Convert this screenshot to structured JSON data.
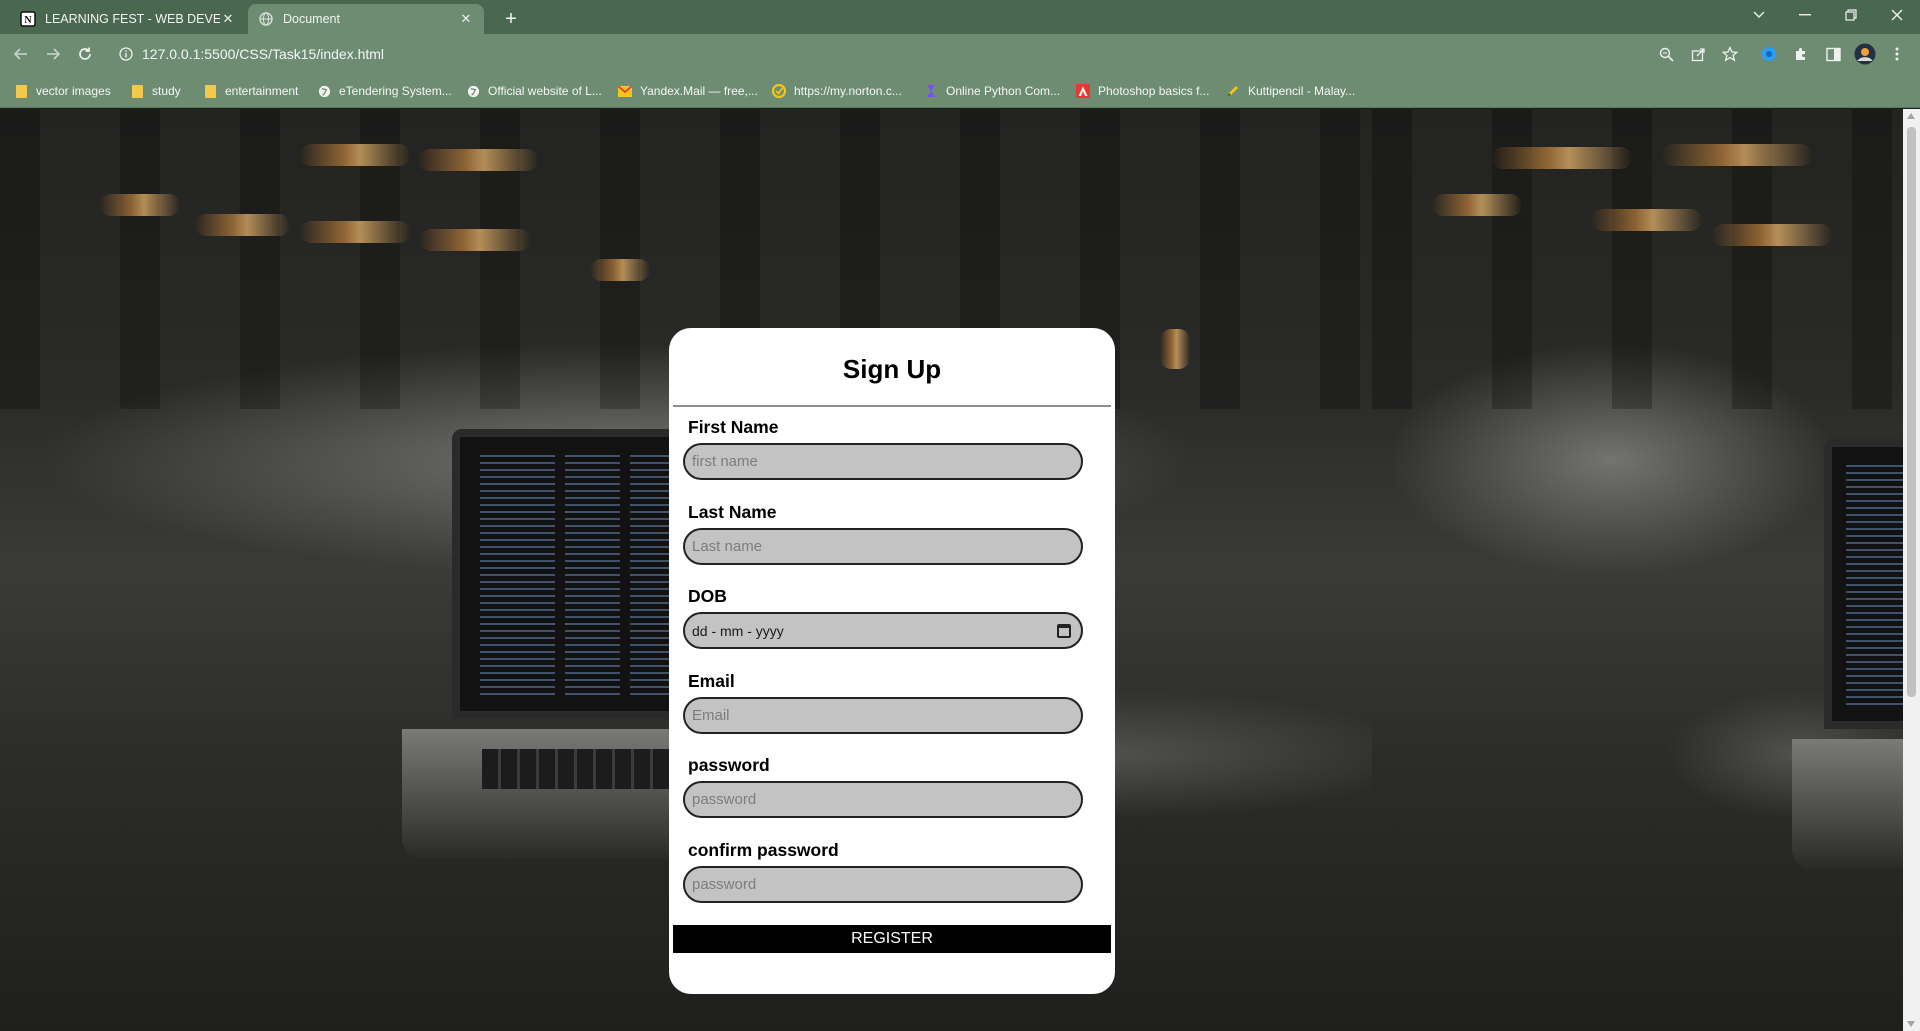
{
  "browser": {
    "tabs": [
      {
        "title": "LEARNING FEST - WEB DEVELOP",
        "active": false,
        "icon": "notion-icon"
      },
      {
        "title": "Document",
        "active": true,
        "icon": "globe-icon"
      }
    ],
    "address": "127.0.0.1:5500/CSS/Task15/index.html",
    "bookmarks": [
      {
        "label": "vector images",
        "icon": "folder-icon"
      },
      {
        "label": "study",
        "icon": "folder-icon"
      },
      {
        "label": "entertainment",
        "icon": "folder-icon"
      },
      {
        "label": "eTendering System...",
        "icon": "globe-icon"
      },
      {
        "label": "Official website of L...",
        "icon": "globe-icon"
      },
      {
        "label": "Yandex.Mail — free,...",
        "icon": "mail-icon"
      },
      {
        "label": "https://my.norton.c...",
        "icon": "norton-icon"
      },
      {
        "label": "Online Python Com...",
        "icon": "python-icon"
      },
      {
        "label": "Photoshop basics f...",
        "icon": "adobe-icon"
      },
      {
        "label": "Kuttipencil - Malay...",
        "icon": "pencil-icon"
      }
    ]
  },
  "form": {
    "title": "Sign Up",
    "fields": {
      "first_name": {
        "label": "First Name",
        "placeholder": "first name"
      },
      "last_name": {
        "label": "Last Name",
        "placeholder": "Last name"
      },
      "dob": {
        "label": "DOB",
        "placeholder": "dd - mm - yyyy"
      },
      "email": {
        "label": "Email",
        "placeholder": "Email"
      },
      "password": {
        "label": "password",
        "placeholder": "password"
      },
      "confirm_password": {
        "label": "confirm password",
        "placeholder": "password"
      }
    },
    "submit_label": "REGISTER"
  },
  "colors": {
    "chrome": "#4a6750",
    "toolbar": "#6d8c72",
    "card": "#ffffff",
    "input_bg": "#c3c3c3",
    "button": "#000000"
  }
}
